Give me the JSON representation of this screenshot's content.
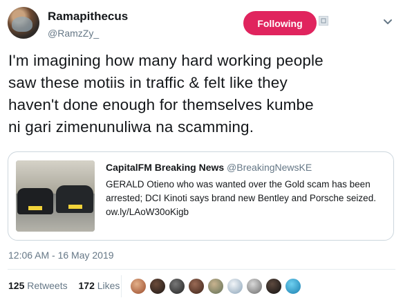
{
  "tweet": {
    "author_name": "Ramapithecus",
    "author_handle": "@RamzZy_",
    "follow_label": "Following",
    "lines": [
      "I'm imagining how many hard working people",
      "saw these motiis in traffic & felt like they",
      "haven't done enough for themselves kumbe",
      "ni gari zimenunuliwa na scamming."
    ],
    "timestamp": "12:06 AM - 16 May 2019"
  },
  "quote": {
    "author_name": "CapitalFM Breaking News",
    "author_handle": "@BreakingNewsKE",
    "lines": [
      "GERALD Otieno who was wanted over the Gold scam has been",
      "arrested; DCI Kinoti says brand new Bentley and Porsche seized.",
      "ow.ly/LAoW30oKigb"
    ]
  },
  "stats": {
    "retweets_count": "125",
    "retweets_label": "Retweets",
    "likes_count": "172",
    "likes_label": "Likes"
  },
  "colors": {
    "follow_button": "#e0245e",
    "secondary_text": "#657786",
    "border": "#ccd6dd"
  },
  "icons": {
    "caret": "chevron-down-icon",
    "notification": "notification-icon"
  }
}
